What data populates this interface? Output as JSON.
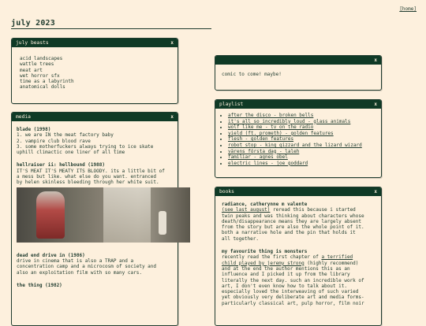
{
  "nav": {
    "home_label": "[home]"
  },
  "page": {
    "title": "july 2023"
  },
  "windows": {
    "beasts": {
      "title": "july beasts",
      "close": "x",
      "items": [
        "acid landscapes",
        "wattle trees",
        "meat art",
        "wet horror sfx",
        "time as a labyrinth",
        "anatomical dolls"
      ]
    },
    "comic": {
      "close": "x",
      "text": "comic to come! maybe!"
    },
    "playlist": {
      "title": "playlist",
      "close": "x",
      "items": [
        "after the disco - broken bells",
        "it's all so incredibly loud - glass animals",
        "wolf like me - tv on the radio",
        "yield (ft. prometh) - golden features",
        "flesh - golden features",
        "robot stop - king gizzard and the lizard wizard",
        "värens första dag - laleh",
        "familiar - agnes obel",
        "electric lines - joe goddard"
      ]
    },
    "media": {
      "title": "media",
      "close": "x",
      "entries": [
        {
          "title": "blade (1998)",
          "lines": [
            "1. we are IN the meat factory baby",
            "2. vampire club blood rave",
            "3. some motherfuckers always trying to ice skate",
            "uphill climactic one liner of all time"
          ]
        },
        {
          "title": "hellraiser ii: hellbound (1988)",
          "lines": [
            "IT'S MEAT IT'S MEATY ITS BLOODY. its a little bit of",
            "a mess but like. what else do you want. entranced",
            "by helen skinless bleeding through her white suit."
          ]
        },
        {
          "title": "dead end drive in (1986)",
          "lines": [
            "drive in cinema that is also a TRAP and a",
            "concentration camp and a microcosm of society and",
            "also an exploitation film with so many cars."
          ]
        },
        {
          "title": "the thing (1982)",
          "lines": []
        }
      ]
    },
    "books": {
      "title": "books",
      "close": "x",
      "entry1": {
        "title": "radiance, catherynne m valente",
        "link": "(see last august)",
        "lines": [
          " reread this because i started",
          "twin peaks and was thinking about characters whose",
          "death/disappearance means they are largely absent",
          "from the story but are also the whole point of it.",
          "both a narrative hole and the pin that holds it",
          "all together."
        ]
      },
      "entry2": {
        "title": "my favourite thing is monsters",
        "pre": "recently read the first chapter of ",
        "link1": "a terrified",
        "link2": "child played by jeremy strong",
        "lines": [
          " (highly recommend)",
          "and at the end the author mentions this as an",
          "influence and I picked it up from the library",
          "literally the next day. such an incredible work of",
          "art, I don't even know how to talk about it.",
          "especially loved the interweaving of such varied",
          "yet obviously very deliberate art and media forms-",
          "particularly classical art, pulp horror, film noir"
        ]
      }
    }
  }
}
